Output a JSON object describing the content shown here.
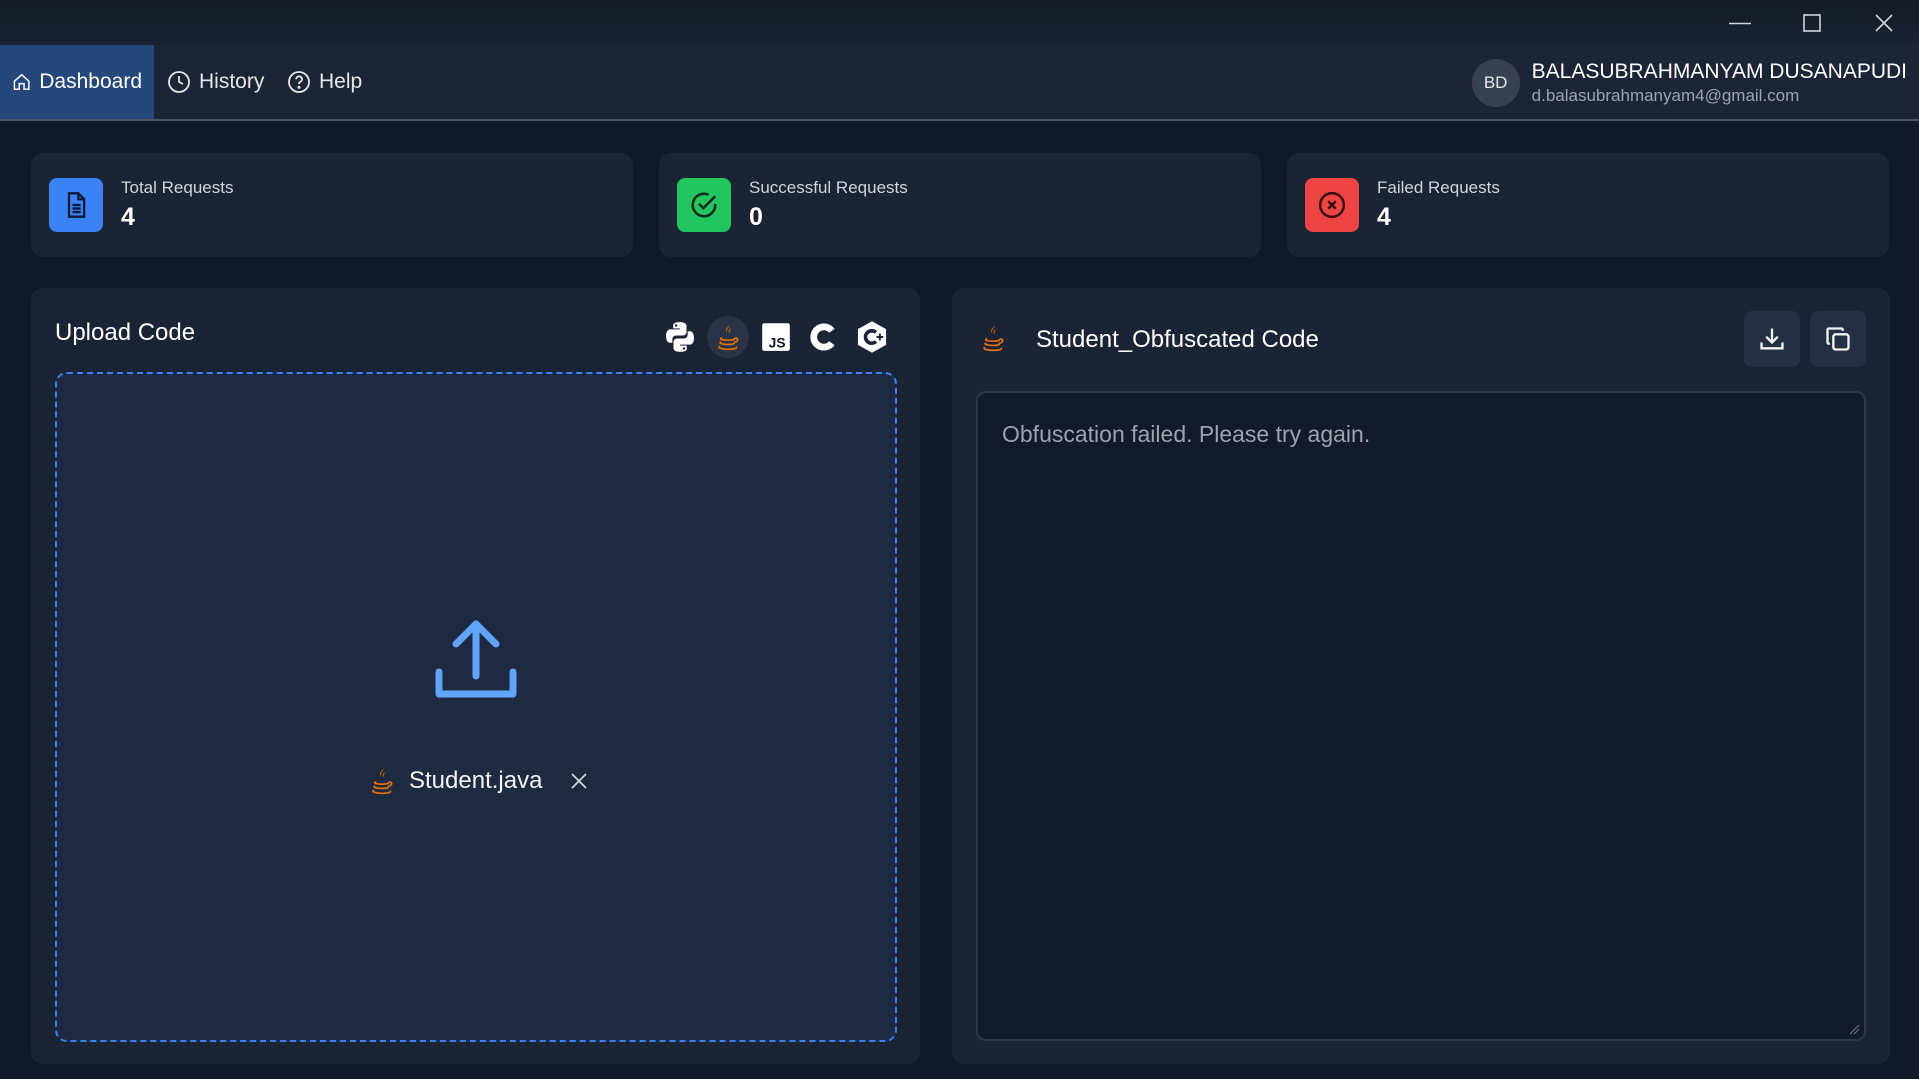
{
  "window": {
    "minimize_icon": "minimize-icon",
    "maximize_icon": "maximize-icon",
    "close_icon": "close-icon"
  },
  "nav": {
    "items": [
      {
        "label": "Dashboard",
        "icon": "home-icon",
        "active": true
      },
      {
        "label": "History",
        "icon": "clock-icon",
        "active": false
      },
      {
        "label": "Help",
        "icon": "help-circle-icon",
        "active": false
      }
    ]
  },
  "user": {
    "initials": "BD",
    "name": "BALASUBRAHMANYAM DUSANAPUDI",
    "email": "d.balasubrahmanyam4@gmail.com"
  },
  "stats": [
    {
      "label": "Total Requests",
      "value": "4",
      "icon": "document-icon",
      "color": "#3b82f6"
    },
    {
      "label": "Successful Requests",
      "value": "0",
      "icon": "check-circle-icon",
      "color": "#22c55e"
    },
    {
      "label": "Failed Requests",
      "value": "4",
      "icon": "x-circle-icon",
      "color": "#ef4444"
    }
  ],
  "upload": {
    "title": "Upload Code",
    "languages": [
      "python-icon",
      "java-icon",
      "javascript-icon",
      "c-icon",
      "cpp-icon"
    ],
    "selected_language": "java-icon",
    "file": {
      "name": "Student.java",
      "icon": "java-icon"
    }
  },
  "output": {
    "title": "Student_Obfuscated Code",
    "icon": "java-icon",
    "download_icon": "download-icon",
    "copy_icon": "copy-icon",
    "text": "Obfuscation failed. Please try again."
  },
  "colors": {
    "accent": "#3b82f6",
    "success": "#22c55e",
    "danger": "#ef4444",
    "java": "#e76f00",
    "nav_active": "#25477a"
  }
}
